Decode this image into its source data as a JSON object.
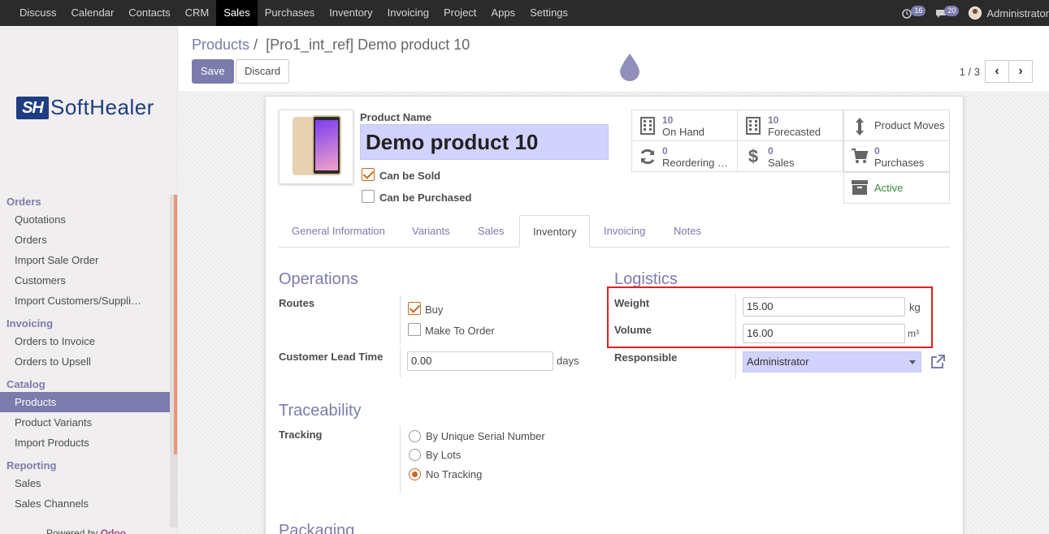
{
  "topbar": {
    "menu": [
      "Discuss",
      "Calendar",
      "Contacts",
      "CRM",
      "Sales",
      "Purchases",
      "Inventory",
      "Invoicing",
      "Project",
      "Apps",
      "Settings"
    ],
    "active_menu": "Sales",
    "messages_count": "16",
    "chat_count": "20",
    "user": "Administrator"
  },
  "sidebar": {
    "logo_text": "SoftHealer",
    "sections": [
      {
        "title": "Orders",
        "items": [
          "Quotations",
          "Orders",
          "Import Sale Order",
          "Customers",
          "Import Customers/Suppli…"
        ]
      },
      {
        "title": "Invoicing",
        "items": [
          "Orders to Invoice",
          "Orders to Upsell"
        ]
      },
      {
        "title": "Catalog",
        "items": [
          "Products",
          "Product Variants",
          "Import Products"
        ]
      },
      {
        "title": "Reporting",
        "items": [
          "Sales",
          "Sales Channels"
        ]
      }
    ],
    "active_item": "Products",
    "powered_by": "Powered by",
    "powered_brand": "Odoo"
  },
  "control": {
    "breadcrumb_parent": "Products",
    "breadcrumb_sep": "/",
    "breadcrumb_current": "[Pro1_int_ref] Demo product 10",
    "save_label": "Save",
    "discard_label": "Discard",
    "pager_value": "1 / 3",
    "pager_prev": "‹",
    "pager_next": "›"
  },
  "product": {
    "name_label": "Product Name",
    "name": "Demo product 10",
    "can_be_sold_label": "Can be Sold",
    "can_be_sold": true,
    "can_be_purchased_label": "Can be Purchased",
    "can_be_purchased": false
  },
  "smart_buttons": {
    "on_hand_num": "10",
    "on_hand_label": "On Hand",
    "forecasted_num": "10",
    "forecasted_label": "Forecasted",
    "moves_label": "Product Moves",
    "reordering_num": "0",
    "reordering_label": "Reordering Rules",
    "sales_num": "0",
    "sales_label": "Sales",
    "purchases_num": "0",
    "purchases_label": "Purchases",
    "active_label": "Active"
  },
  "tabs": [
    "General Information",
    "Variants",
    "Sales",
    "Inventory",
    "Invoicing",
    "Notes"
  ],
  "active_tab": "Inventory",
  "operations": {
    "title": "Operations",
    "routes_label": "Routes",
    "route_buy": "Buy",
    "route_buy_checked": true,
    "route_mto": "Make To Order",
    "route_mto_checked": false,
    "lead_time_label": "Customer Lead Time",
    "lead_time_value": "0.00",
    "lead_time_unit": "days"
  },
  "logistics": {
    "title": "Logistics",
    "weight_label": "Weight",
    "weight_value": "15.00",
    "weight_unit": "kg",
    "volume_label": "Volume",
    "volume_value": "16.00",
    "volume_unit": "m³",
    "responsible_label": "Responsible",
    "responsible_value": "Administrator"
  },
  "traceability": {
    "title": "Traceability",
    "tracking_label": "Tracking",
    "options": [
      "By Unique Serial Number",
      "By Lots",
      "No Tracking"
    ],
    "selected": "No Tracking"
  },
  "packaging": {
    "title": "Packaging"
  },
  "colors": {
    "accent": "#7c7bad",
    "topbar": "#2b2b2b",
    "highlight": "#e02020",
    "check": "#c9691e"
  }
}
